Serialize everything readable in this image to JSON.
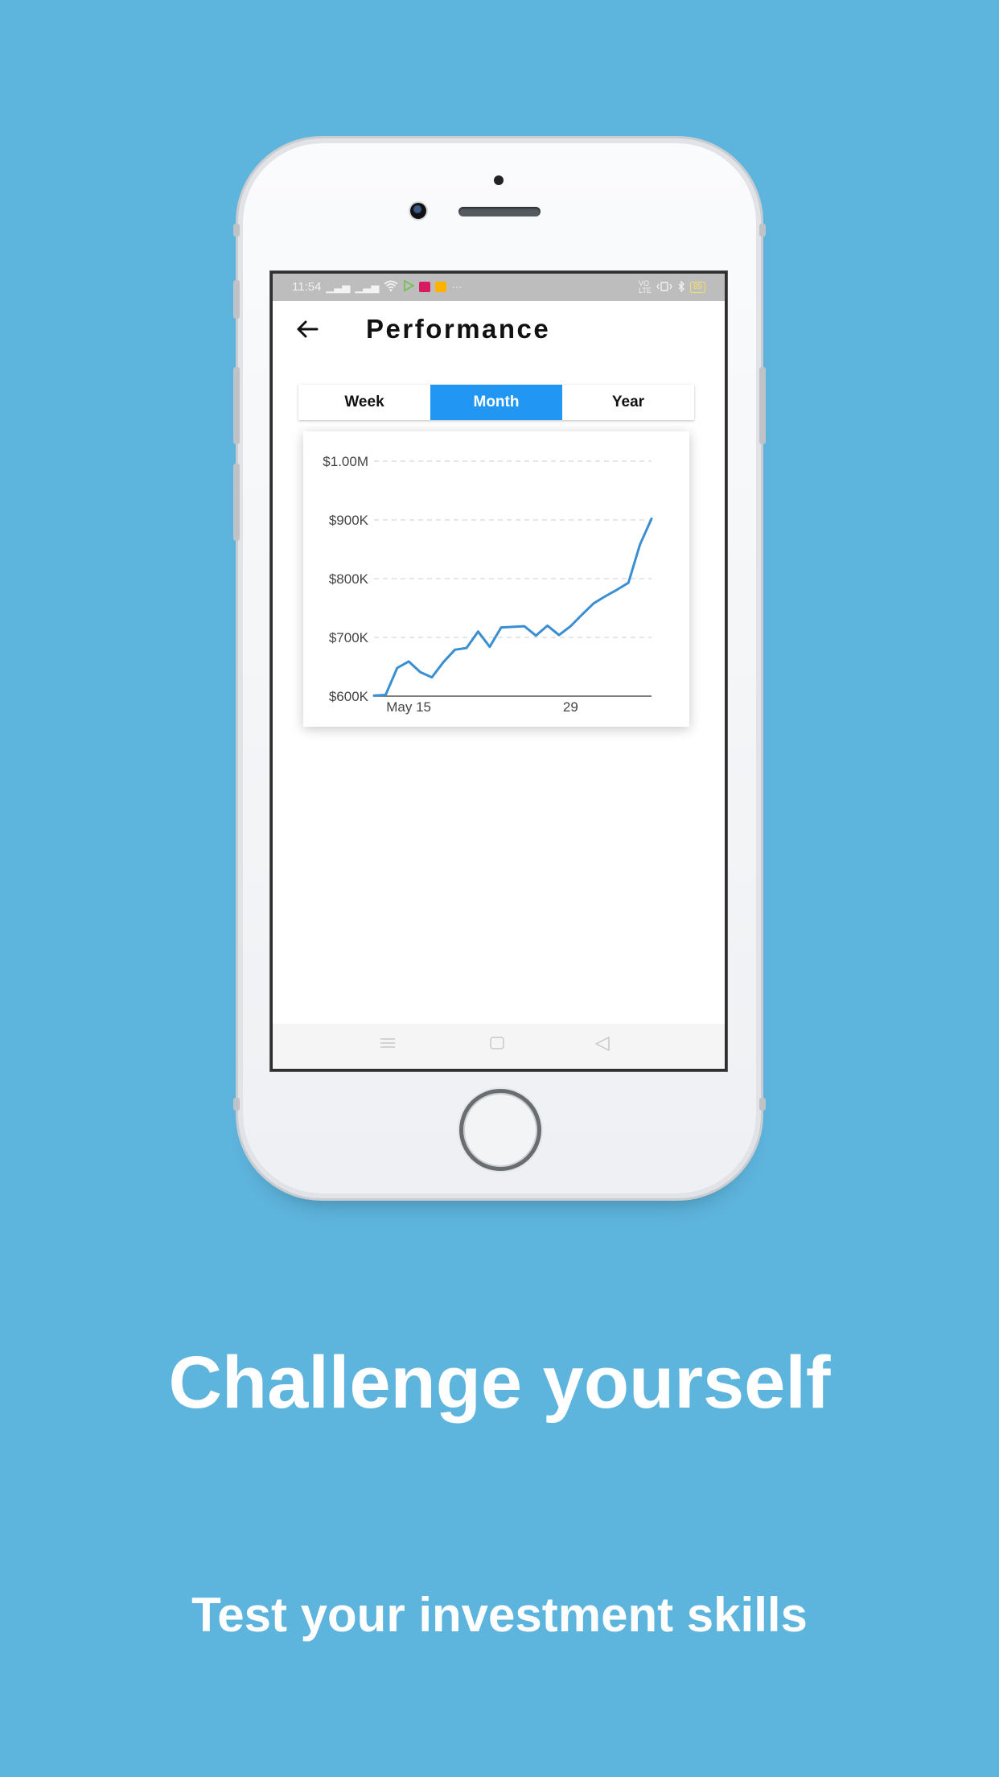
{
  "status_bar": {
    "time": "11:54",
    "battery": "89"
  },
  "header": {
    "title": "Performance",
    "back_icon": "arrow-left-icon"
  },
  "tabs": [
    {
      "label": "Week",
      "active": false
    },
    {
      "label": "Month",
      "active": true
    },
    {
      "label": "Year",
      "active": false
    }
  ],
  "colors": {
    "background": "#5db4dd",
    "accent": "#2196f3",
    "line": "#3a8fd2"
  },
  "chart_data": {
    "type": "line",
    "x_tick_labels": [
      "May 15",
      "29"
    ],
    "x_tick_days": [
      15,
      29
    ],
    "y_tick_labels": [
      "$600K",
      "$700K",
      "$800K",
      "$900K",
      "$1.00M"
    ],
    "ylim": [
      600000,
      1000000
    ],
    "xlim": [
      12,
      36
    ],
    "grid": true,
    "series": [
      {
        "x": [
          12,
          13,
          14,
          15,
          16,
          17,
          18,
          19,
          20,
          21,
          22,
          23,
          24,
          25,
          26,
          27,
          28,
          29,
          30,
          31,
          32,
          33,
          34,
          35,
          36
        ],
        "values": [
          601000,
          602000,
          648000,
          659000,
          641000,
          632000,
          658000,
          679000,
          682000,
          710000,
          684000,
          717000,
          718000,
          719000,
          703000,
          720000,
          704000,
          719000,
          739000,
          758000,
          770000,
          781000,
          793000,
          858000,
          902000
        ]
      }
    ]
  },
  "nav": {
    "menu_icon": "menu-icon",
    "home_icon": "home-square-icon",
    "back_icon": "back-triangle-icon"
  },
  "marketing": {
    "headline": "Challenge yourself",
    "subline": "Test your investment skills"
  }
}
